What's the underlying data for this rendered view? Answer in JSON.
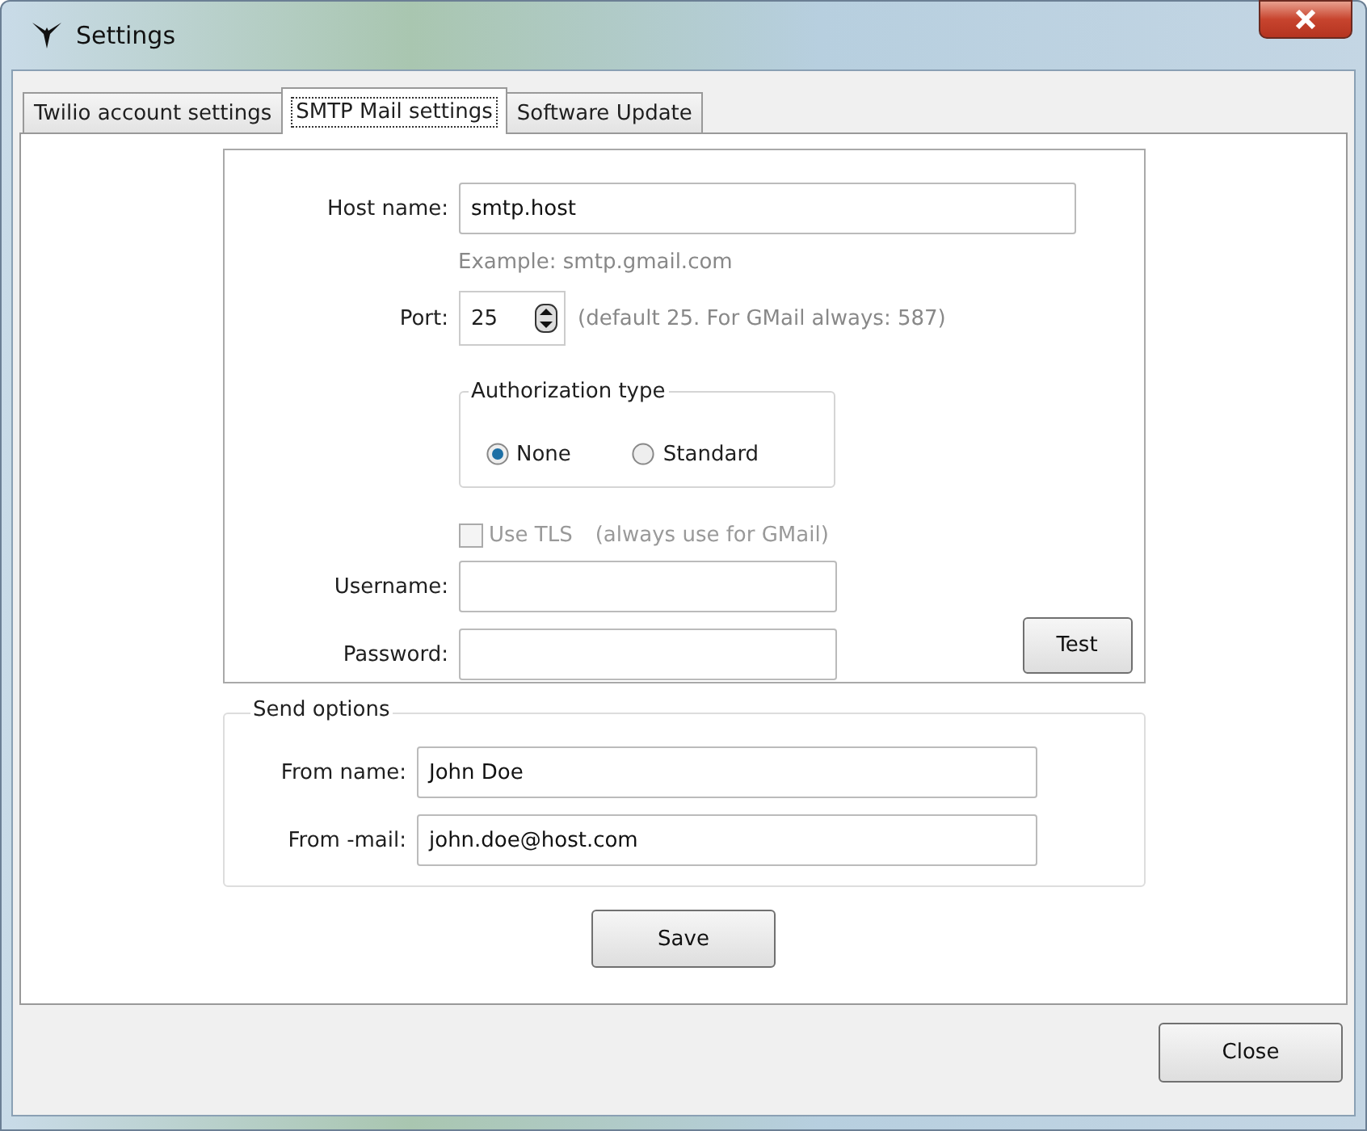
{
  "window": {
    "title": "Settings"
  },
  "tabs": [
    {
      "label": "Twilio account settings",
      "selected": false
    },
    {
      "label": "SMTP Mail settings",
      "selected": true
    },
    {
      "label": "Software Update",
      "selected": false
    }
  ],
  "smtp": {
    "host_name": {
      "label": "Host name:",
      "value": "smtp.host",
      "hint": "Example: smtp.gmail.com"
    },
    "port": {
      "label": "Port:",
      "value": "25",
      "note": "(default 25. For GMail always: 587)"
    },
    "authorization": {
      "title": "Authorization type",
      "options": [
        {
          "label": "None",
          "selected": true
        },
        {
          "label": "Standard",
          "selected": false
        }
      ]
    },
    "use_tls": {
      "label": "Use TLS",
      "note": "(always use for GMail)",
      "checked": false,
      "disabled": true
    },
    "username": {
      "label": "Username:"
    },
    "password": {
      "label": "Password:"
    },
    "test_button": "Test"
  },
  "send_options": {
    "title": "Send options",
    "from_name": {
      "label": "From name:",
      "value": "John Doe"
    },
    "from_email": {
      "label": "From -mail:",
      "value": "john.doe@host.com"
    }
  },
  "save_button": "Save",
  "close_button": "Close"
}
